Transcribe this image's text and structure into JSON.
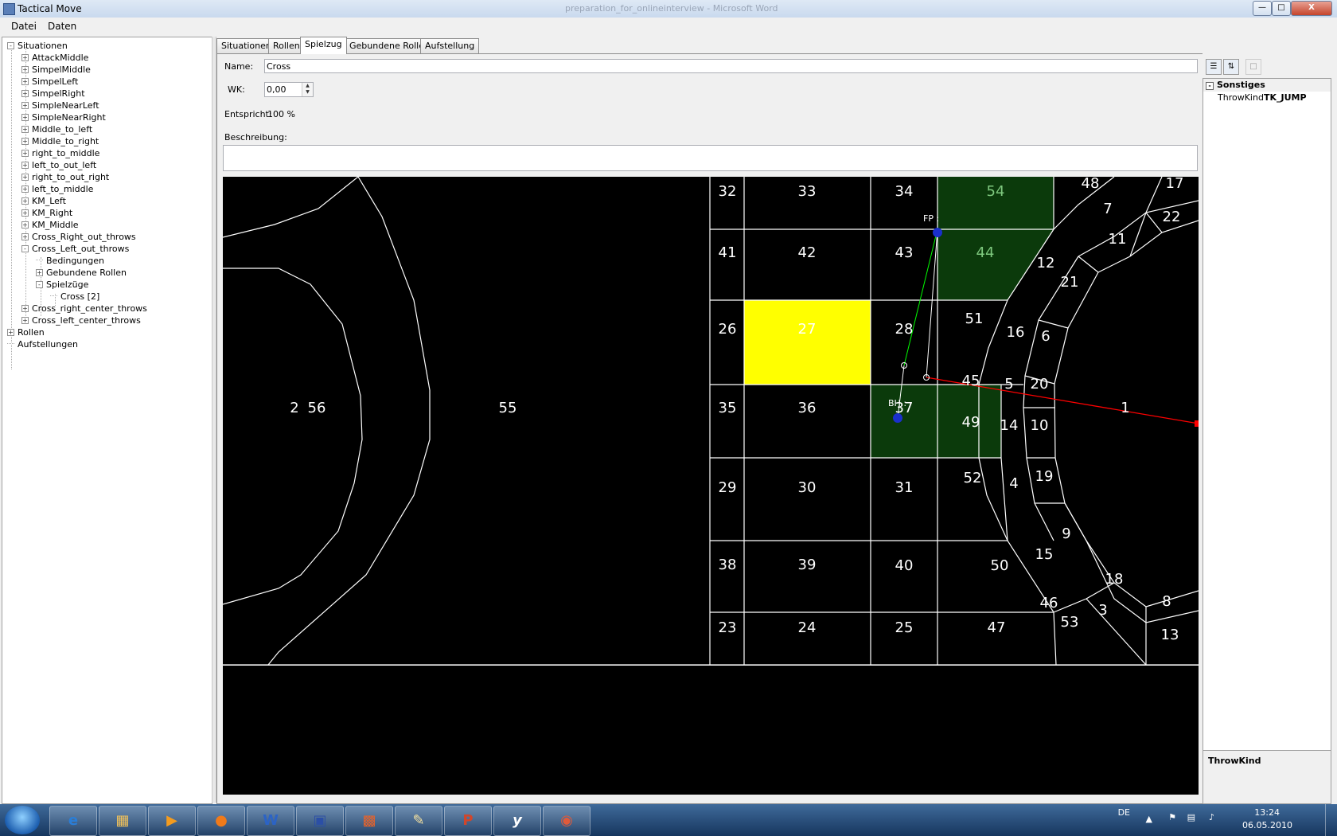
{
  "window": {
    "title": "Tactical Move",
    "background_title": "preparation_for_onlineinterview - Microsoft Word"
  },
  "menu": {
    "items": [
      "Datei",
      "Daten"
    ]
  },
  "tree": {
    "items": [
      {
        "label": "Situationen",
        "level": 0,
        "expander": "-"
      },
      {
        "label": "AttackMiddle",
        "level": 1,
        "expander": "+"
      },
      {
        "label": "SimpelMiddle",
        "level": 1,
        "expander": "+"
      },
      {
        "label": "SimpelLeft",
        "level": 1,
        "expander": "+"
      },
      {
        "label": "SimpelRight",
        "level": 1,
        "expander": "+"
      },
      {
        "label": "SimpleNearLeft",
        "level": 1,
        "expander": "+"
      },
      {
        "label": "SimpleNearRight",
        "level": 1,
        "expander": "+"
      },
      {
        "label": "Middle_to_left",
        "level": 1,
        "expander": "+"
      },
      {
        "label": "Middle_to_right",
        "level": 1,
        "expander": "+"
      },
      {
        "label": "right_to_middle",
        "level": 1,
        "expander": "+"
      },
      {
        "label": "left_to_out_left",
        "level": 1,
        "expander": "+"
      },
      {
        "label": "right_to_out_right",
        "level": 1,
        "expander": "+"
      },
      {
        "label": "left_to_middle",
        "level": 1,
        "expander": "+"
      },
      {
        "label": "KM_Left",
        "level": 1,
        "expander": "+"
      },
      {
        "label": "KM_Right",
        "level": 1,
        "expander": "+"
      },
      {
        "label": "KM_Middle",
        "level": 1,
        "expander": "+"
      },
      {
        "label": "Cross_Right_out_throws",
        "level": 1,
        "expander": "+"
      },
      {
        "label": "Cross_Left_out_throws",
        "level": 1,
        "expander": "-"
      },
      {
        "label": "Bedingungen",
        "level": 2,
        "expander": ""
      },
      {
        "label": "Gebundene Rollen",
        "level": 2,
        "expander": "+"
      },
      {
        "label": "Spielzüge",
        "level": 2,
        "expander": "-"
      },
      {
        "label": "Cross [2]",
        "level": 3,
        "expander": ""
      },
      {
        "label": "Cross_right_center_throws",
        "level": 1,
        "expander": "+"
      },
      {
        "label": "Cross_left_center_throws",
        "level": 1,
        "expander": "+"
      },
      {
        "label": "Rollen",
        "level": 0,
        "expander": "+"
      },
      {
        "label": "Aufstellungen",
        "level": 0,
        "expander": ""
      }
    ]
  },
  "tabs": [
    "Situationen",
    "Rollen",
    "Spielzug",
    "Gebundene Rolle",
    "Aufstellung"
  ],
  "form": {
    "name_label": "Name:",
    "name_value": "Cross",
    "wk_label": "WK:",
    "wk_value": "0,00",
    "entspricht_label": "Entspricht:",
    "entspricht_value": "100 %",
    "beschreibung_label": "Beschreibung:"
  },
  "field": {
    "colors": {
      "background": "#000000",
      "line": "#ffffff",
      "highlight": "#ffff00",
      "selected_zone": "#0b3a0b",
      "pass_line": "#00ff00",
      "throw_line": "#ff0000",
      "player": "#1a2fcc"
    },
    "zones": [
      "1",
      "2",
      "3",
      "4",
      "5",
      "6",
      "7",
      "8",
      "9",
      "10",
      "11",
      "12",
      "13",
      "14",
      "15",
      "16",
      "17",
      "18",
      "19",
      "20",
      "21",
      "22",
      "23",
      "24",
      "25",
      "26",
      "27",
      "28",
      "29",
      "30",
      "31",
      "32",
      "33",
      "34",
      "35",
      "36",
      "37",
      "38",
      "39",
      "40",
      "41",
      "42",
      "43",
      "44",
      "45",
      "46",
      "47",
      "48",
      "49",
      "50",
      "51",
      "52",
      "53",
      "54",
      "55",
      "56"
    ],
    "highlighted_zone": "27",
    "green_zones": [
      "54",
      "44",
      "37",
      "49"
    ],
    "players": [
      {
        "label": "FP :"
      },
      {
        "label": "BH :"
      }
    ]
  },
  "properties": {
    "category": "Sonstiges",
    "prop_name": "ThrowKind",
    "prop_value": "TK_JUMP",
    "description_title": "ThrowKind"
  },
  "taskbar": {
    "apps": [
      "start",
      "ie",
      "explorer",
      "media",
      "firefox",
      "word",
      "save",
      "office",
      "notepad",
      "powerpoint",
      "yed",
      "tactical"
    ],
    "lang": "DE",
    "time": "13:24",
    "date": "06.05.2010"
  }
}
